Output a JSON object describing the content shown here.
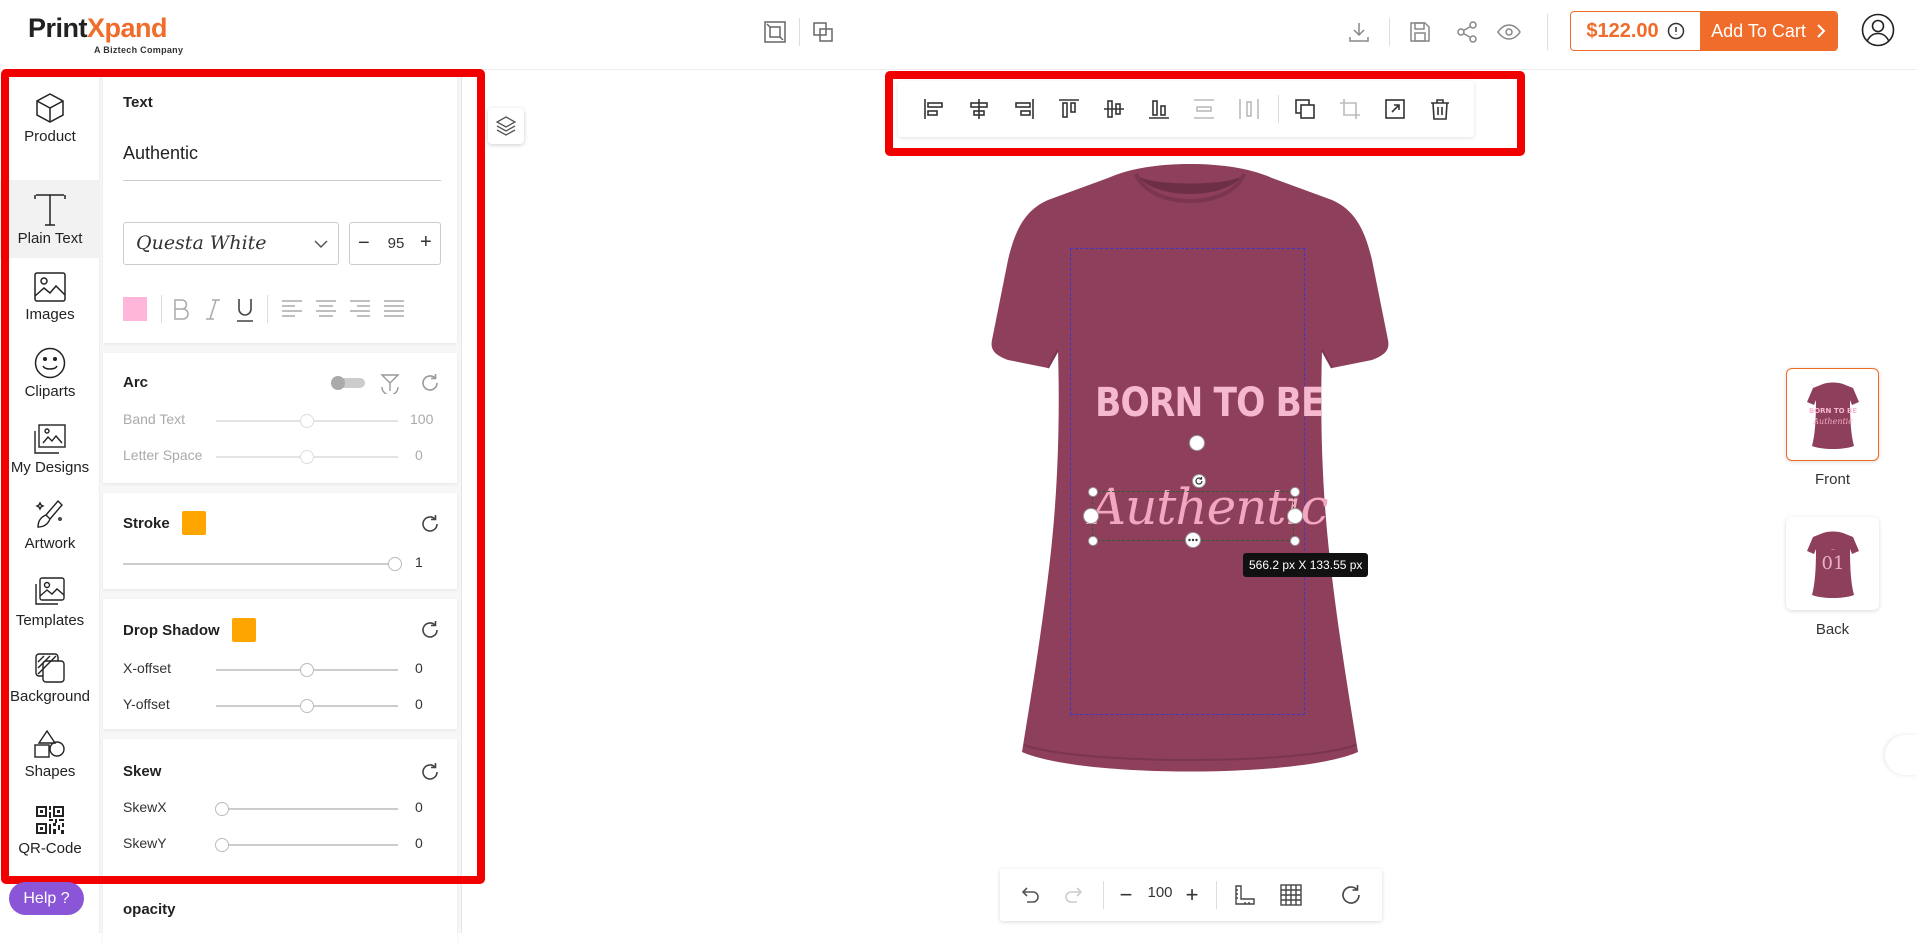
{
  "brand": {
    "name_part1": "Print",
    "name_part2": "Xpand",
    "tagline": "A Biztech Company",
    "accent": "#ef6c2b"
  },
  "header": {
    "price": "$122.00",
    "add_to_cart": "Add To Cart"
  },
  "sidebar": {
    "items": [
      {
        "label": "Product",
        "icon": "cube-icon"
      },
      {
        "label": "Plain Text",
        "icon": "text-icon",
        "active": true
      },
      {
        "label": "Images",
        "icon": "image-icon"
      },
      {
        "label": "Cliparts",
        "icon": "smiley-icon"
      },
      {
        "label": "My Designs",
        "icon": "my-designs-icon"
      },
      {
        "label": "Artwork",
        "icon": "artwork-icon"
      },
      {
        "label": "Templates",
        "icon": "templates-icon"
      },
      {
        "label": "Background",
        "icon": "background-icon"
      },
      {
        "label": "Shapes",
        "icon": "shapes-icon"
      },
      {
        "label": "QR-Code",
        "icon": "qr-code-icon"
      }
    ]
  },
  "text_panel": {
    "title": "Text",
    "value": "Authentic",
    "font_name": "Questa White",
    "font_size": "95",
    "text_color": "#ffb6d9"
  },
  "arc": {
    "title": "Arc",
    "band_text_label": "Band Text",
    "band_text_value": "100",
    "letter_space_label": "Letter Space",
    "letter_space_value": "0"
  },
  "stroke": {
    "title": "Stroke",
    "value": "1",
    "color": "#ffa500"
  },
  "drop_shadow": {
    "title": "Drop Shadow",
    "color": "#ffa500",
    "x_label": "X-offset",
    "x_value": "0",
    "y_label": "Y-offset",
    "y_value": "0"
  },
  "skew": {
    "title": "Skew",
    "x_label": "SkewX",
    "x_value": "0",
    "y_label": "SkewY",
    "y_value": "0"
  },
  "opacity": {
    "title": "opacity"
  },
  "help": {
    "label": "Help ?"
  },
  "canvas": {
    "shirt_color": "#8e3f5b",
    "line1": "BORN TO BE",
    "line2": "Authentic",
    "size_tooltip": "566.2 px X 133.55 px"
  },
  "views": [
    {
      "label": "Front"
    },
    {
      "label": "Back"
    }
  ],
  "back_thumb_text": "01",
  "bottom_bar": {
    "zoom": "100"
  }
}
